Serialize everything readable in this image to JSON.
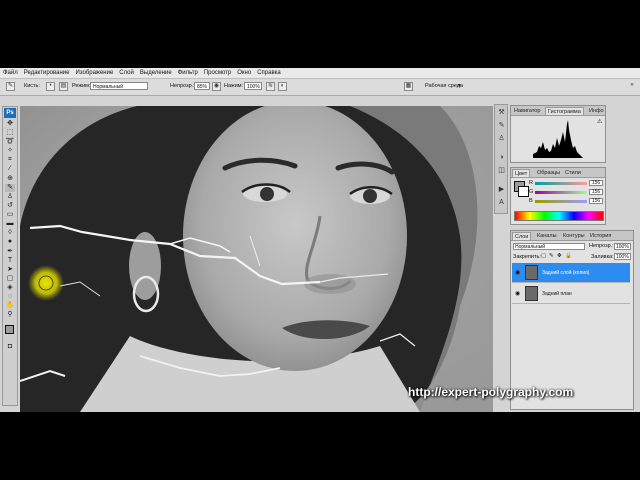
{
  "menu": [
    "Файл",
    "Редактирование",
    "Изображение",
    "Слой",
    "Выделение",
    "Фильтр",
    "Просмотр",
    "Окно",
    "Справка"
  ],
  "options": {
    "brushes_label": "Кисть:",
    "mode_label": "Режим:",
    "mode_value": "Нормальный",
    "opacity_label": "Непрозр.:",
    "opacity_value": "85%",
    "pressure_label": "Нажим:",
    "pressure_value": "100%",
    "workspace_label": "Рабочая среда"
  },
  "toolbox": {
    "logo": "Ps"
  },
  "histogram_panel": {
    "tabs": [
      "Навигатор",
      "Гистограмма",
      "Инфо"
    ],
    "active": "Гистограмма"
  },
  "color_panel": {
    "tabs": [
      "Цвет",
      "Образцы",
      "Стили"
    ],
    "active": "Цвет",
    "channels": [
      {
        "label": "R",
        "value": "156"
      },
      {
        "label": "G",
        "value": "156"
      },
      {
        "label": "B",
        "value": "156"
      }
    ]
  },
  "layers_panel": {
    "tabs": [
      "Слои",
      "Каналы",
      "Контуры",
      "История"
    ],
    "active": "Слои",
    "blend_mode": "Нормальный",
    "opacity_label": "Непрозр.:",
    "opacity_value": "100%",
    "lock_label": "Закрепить:",
    "fill_label": "Заливка:",
    "fill_value": "100%",
    "layers": [
      {
        "name": "Задний слой (копия)",
        "selected": true
      },
      {
        "name": "Задний план",
        "selected": false
      }
    ]
  },
  "watermark": "http://expert-polygraphy.com",
  "colors": {
    "accent": "#2d8cf0",
    "ps_logo": "#1b6fb7",
    "cursor_highlight": "#e6e000"
  },
  "icons": [
    "brush-icon",
    "eye-icon",
    "lock-icon",
    "link-icon",
    "trash-icon",
    "new-layer-icon",
    "ps-logo-icon"
  ]
}
